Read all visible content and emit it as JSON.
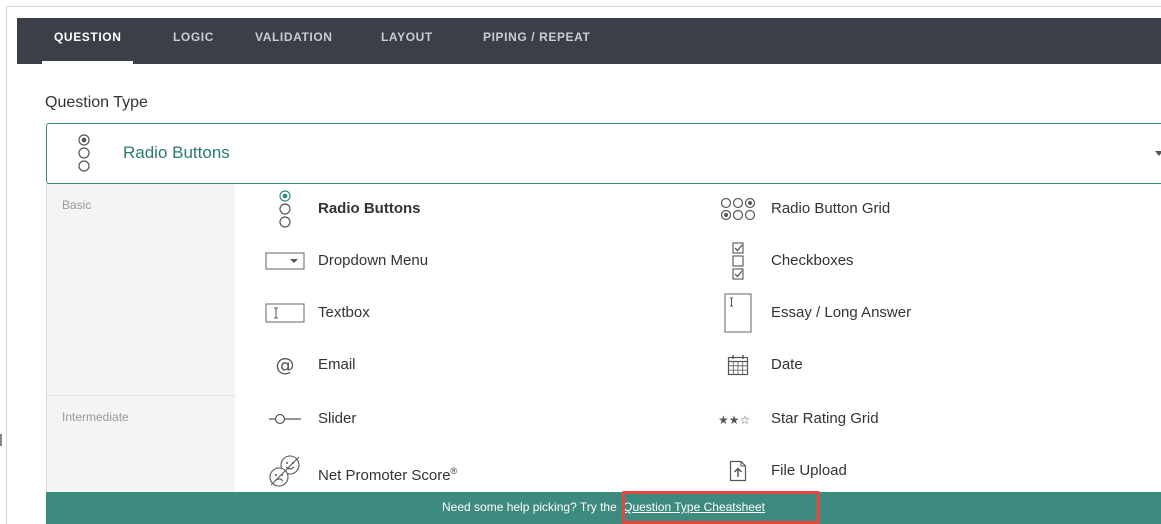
{
  "tabs": [
    {
      "label": "QUESTION",
      "active": true
    },
    {
      "label": "LOGIC",
      "active": false
    },
    {
      "label": "VALIDATION",
      "active": false
    },
    {
      "label": "LAYOUT",
      "active": false
    },
    {
      "label": "PIPING / REPEAT",
      "active": false
    }
  ],
  "question_type": {
    "label": "Question Type",
    "selected": "Radio Buttons",
    "selected_icon": "radio-buttons-icon"
  },
  "groups": [
    {
      "name": "Basic"
    },
    {
      "name": "Intermediate"
    }
  ],
  "options": [
    {
      "label": "Radio Buttons",
      "icon": "radio-buttons-icon",
      "selected": true
    },
    {
      "label": "Radio Button Grid",
      "icon": "radio-grid-icon"
    },
    {
      "label": "Dropdown Menu",
      "icon": "dropdown-icon"
    },
    {
      "label": "Checkboxes",
      "icon": "checkboxes-icon"
    },
    {
      "label": "Textbox",
      "icon": "textbox-icon"
    },
    {
      "label": "Essay / Long Answer",
      "icon": "essay-icon"
    },
    {
      "label": "Email",
      "icon": "at-sign-icon"
    },
    {
      "label": "Date",
      "icon": "calendar-icon"
    },
    {
      "label": "Slider",
      "icon": "slider-icon"
    },
    {
      "label": "Star Rating Grid",
      "icon": "star-rating-icon"
    },
    {
      "label": "Net Promoter Score",
      "label_sup": "®",
      "icon": "nps-icon"
    },
    {
      "label": "File Upload",
      "icon": "file-upload-icon"
    }
  ],
  "footer": {
    "text": "Need some help picking? Try the",
    "link": "Question Type Cheatsheet"
  },
  "colors": {
    "tabbar": "#3b3f47",
    "accent": "#3d8a7e",
    "highlight": "#e8453c"
  }
}
